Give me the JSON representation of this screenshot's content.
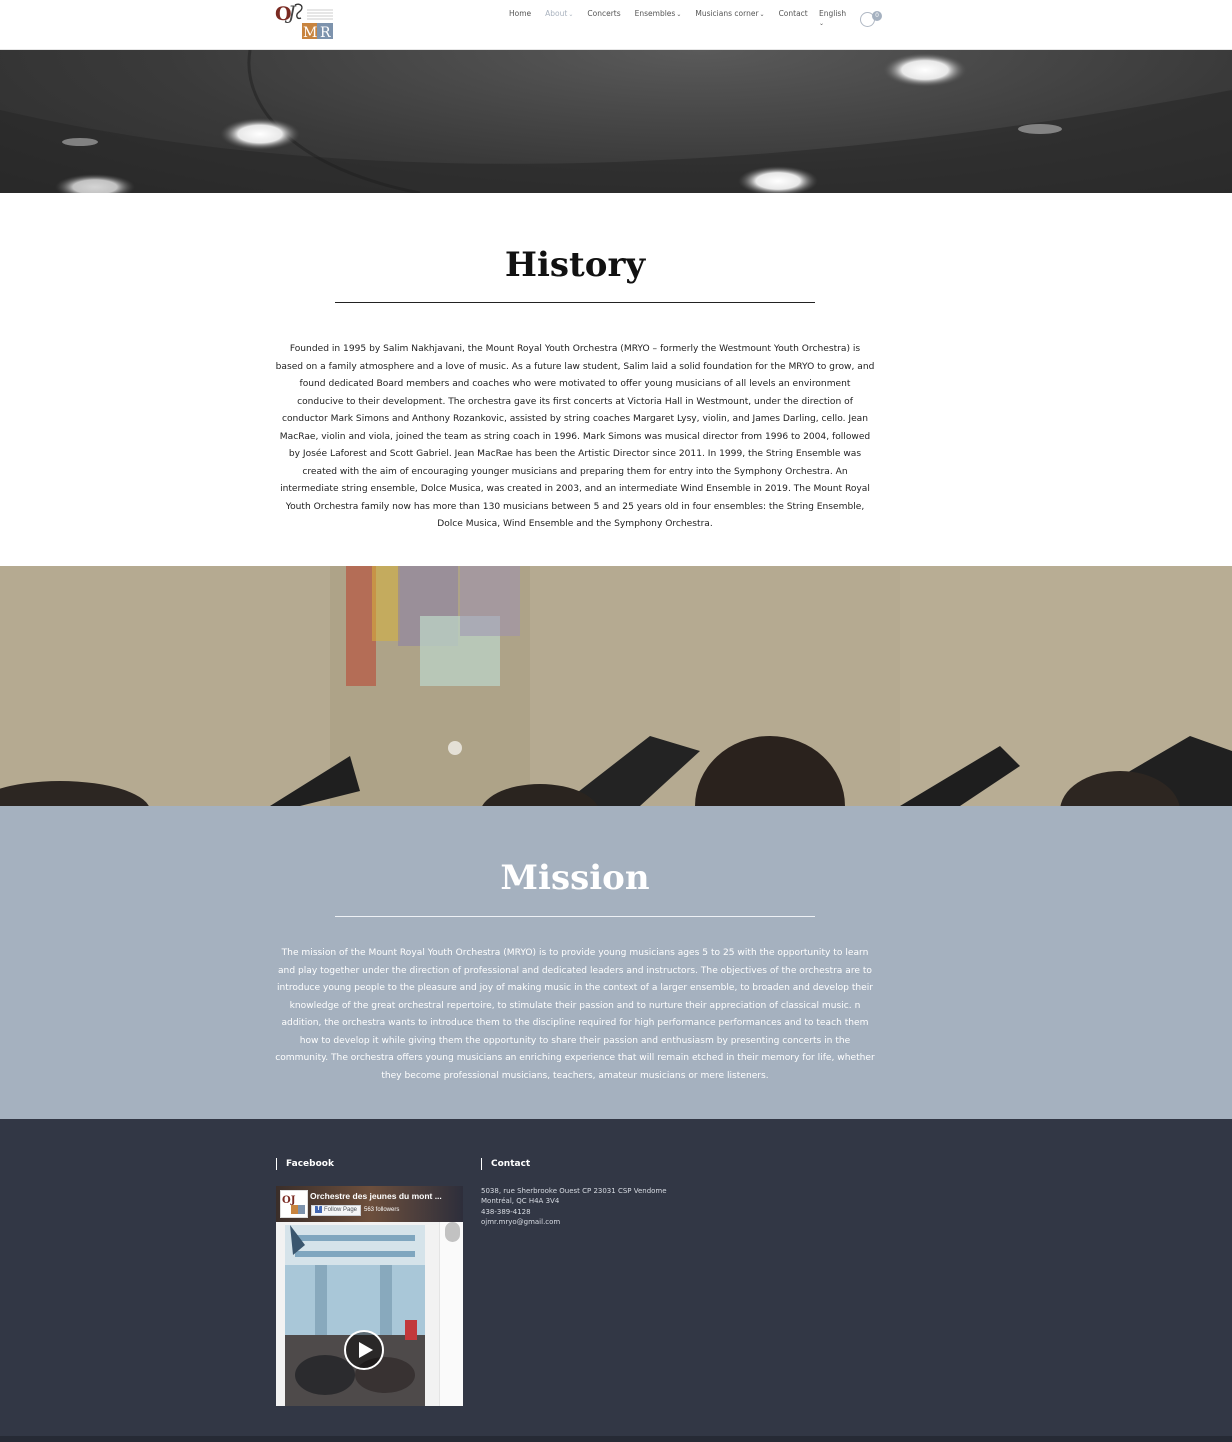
{
  "header": {
    "nav": [
      {
        "label": "Home",
        "dropdown": false,
        "active": false
      },
      {
        "label": "About",
        "dropdown": true,
        "active": true
      },
      {
        "label": "Concerts",
        "dropdown": false,
        "active": false
      },
      {
        "label": "Ensembles",
        "dropdown": true,
        "active": false
      },
      {
        "label": "Musicians corner",
        "dropdown": true,
        "active": false
      },
      {
        "label": "Contact",
        "dropdown": false,
        "active": false
      }
    ],
    "language": "English",
    "cart_count": "0"
  },
  "history": {
    "title": "History",
    "body": "Founded in 1995 by Salim Nakhjavani, the Mount Royal Youth Orchestra (MRYO – formerly the Westmount Youth Orchestra) is based on a family atmosphere and a love of music. As a future law student, Salim laid a solid foundation for the MRYO to grow, and found dedicated Board members and coaches who were motivated to offer young musicians of all levels an environment conducive to their development. The orchestra gave its first concerts at Victoria Hall in Westmount, under the direction of conductor Mark Simons and Anthony Rozankovic, assisted by string coaches Margaret Lysy, violin, and James Darling, cello. Jean MacRae, violin and viola, joined the team as string coach in 1996. Mark Simons was musical director from 1996 to 2004, followed by Josée Laforest and Scott Gabriel. Jean MacRae has been the Artistic Director since 2011. In 1999, the String Ensemble was created with the aim of encouraging younger musicians and preparing them for entry into the Symphony Orchestra. An intermediate string ensemble, Dolce Musica, was created in 2003, and an intermediate Wind Ensemble in 2019. The Mount Royal Youth Orchestra family now has more than 130 musicians between 5 and 25 years old in four ensembles: the String Ensemble, Dolce Musica, Wind Ensemble and the Symphony Orchestra."
  },
  "mission": {
    "title": "Mission",
    "body": "The mission of the Mount Royal Youth Orchestra (MRYO) is to provide young musicians ages 5 to 25 with the opportunity to learn and play together under the direction of professional and dedicated leaders and instructors. The objectives of the orchestra are to introduce young people to the pleasure and joy of making music in the context of a larger ensemble, to broaden and develop their knowledge of the great orchestral repertoire, to stimulate their passion and to nurture their appreciation of classical music. n addition, the orchestra wants to introduce them to the discipline required for high performance performances and to teach them how to develop it while giving them the opportunity to share their passion and enthusiasm by presenting concerts in the community. The orchestra offers young musicians an enriching experience that will remain etched in their memory for life, whether they become professional musicians, teachers, amateur musicians or mere listeners."
  },
  "footer": {
    "facebook": {
      "heading": "Facebook",
      "page_name": "Orchestre des jeunes du mont ...",
      "follow_label": "Follow Page",
      "followers": "563 followers"
    },
    "contact": {
      "heading": "Contact",
      "address1": "5038, rue Sherbrooke Ouest CP 23031 CSP Vendome",
      "address2": "Montréal, QC H4A 3V4",
      "phone": "438-389-4128",
      "email": "ojmr.mryo@gmail.com"
    }
  },
  "colors": {
    "mission_bg": "#a5b1bf",
    "footer_bg": "#323745",
    "nav_active": "#aab3bf"
  }
}
